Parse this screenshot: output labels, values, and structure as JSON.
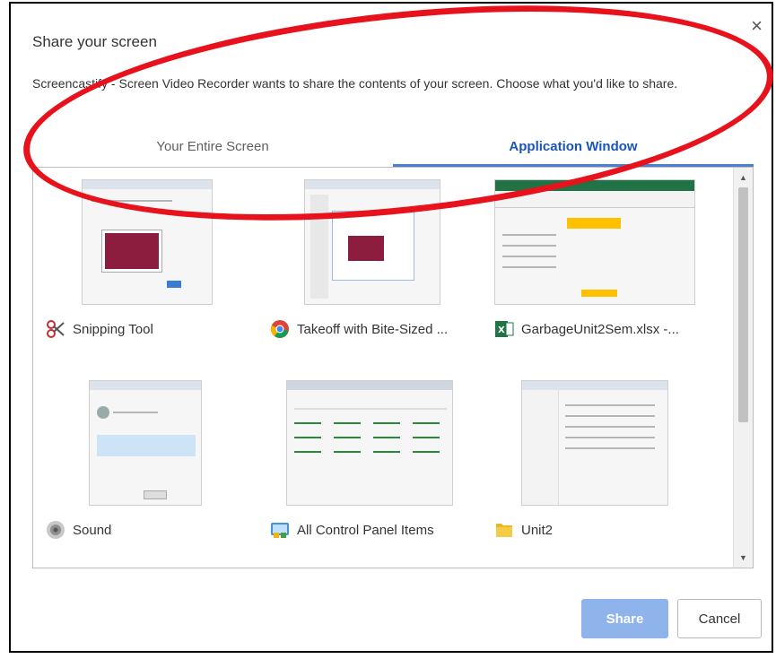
{
  "dialog": {
    "title": "Share your screen",
    "description": "Screencastify - Screen Video Recorder wants to share the contents of your screen. Choose what you'd like to share.",
    "close_glyph": "×"
  },
  "tabs": [
    {
      "label": "Your Entire Screen",
      "selected": false
    },
    {
      "label": "Application Window",
      "selected": true
    }
  ],
  "windows": [
    {
      "title": "Snipping Tool",
      "icon": "snipping-tool-icon"
    },
    {
      "title": "Takeoff with Bite-Sized ...",
      "icon": "chrome-icon"
    },
    {
      "title": "GarbageUnit2Sem.xlsx -...",
      "icon": "excel-icon"
    },
    {
      "title": "Sound",
      "icon": "speaker-icon"
    },
    {
      "title": "All Control Panel Items",
      "icon": "control-panel-icon"
    },
    {
      "title": "Unit2",
      "icon": "folder-icon"
    }
  ],
  "buttons": {
    "share": "Share",
    "cancel": "Cancel"
  },
  "colors": {
    "accent": "#1a55b8",
    "share_disabled": "#8fb4ec",
    "annotation": "#e8121c"
  }
}
